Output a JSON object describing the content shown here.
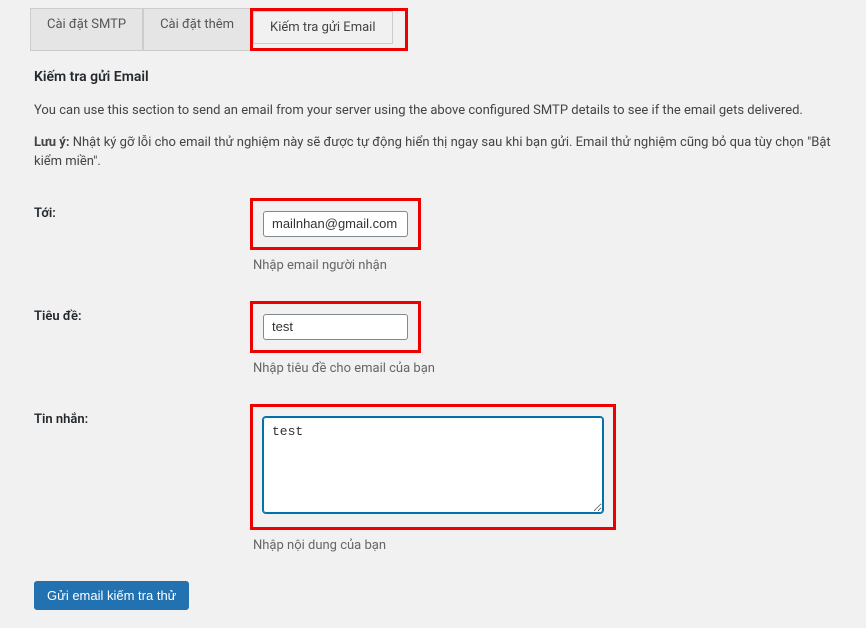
{
  "tabs": {
    "smtp": "Cài đặt SMTP",
    "extra": "Cài đặt thêm",
    "test": "Kiếm tra gửi Email"
  },
  "section_title": "Kiếm tra gửi Email",
  "description": "You can use this section to send an email from your server using the above configured SMTP details to see if the email gets delivered.",
  "note_strong": "Lưu ý:",
  "note_text": " Nhật ký gỡ lỗi cho email thử nghiệm này sẽ được tự động hiển thị ngay sau khi bạn gửi. Email thử nghiệm cũng bỏ qua tùy chọn \"Bật kiểm miền\".",
  "fields": {
    "to": {
      "label": "Tới:",
      "value": "mailnhan@gmail.com",
      "help": "Nhập email người nhận"
    },
    "subject": {
      "label": "Tiêu đề:",
      "value": "test",
      "help": "Nhập tiêu đề cho email của bạn"
    },
    "message": {
      "label": "Tin nhắn:",
      "value": "test",
      "help": "Nhập nội dung của bạn"
    }
  },
  "submit_label": "Gửi email kiếm tra thử"
}
